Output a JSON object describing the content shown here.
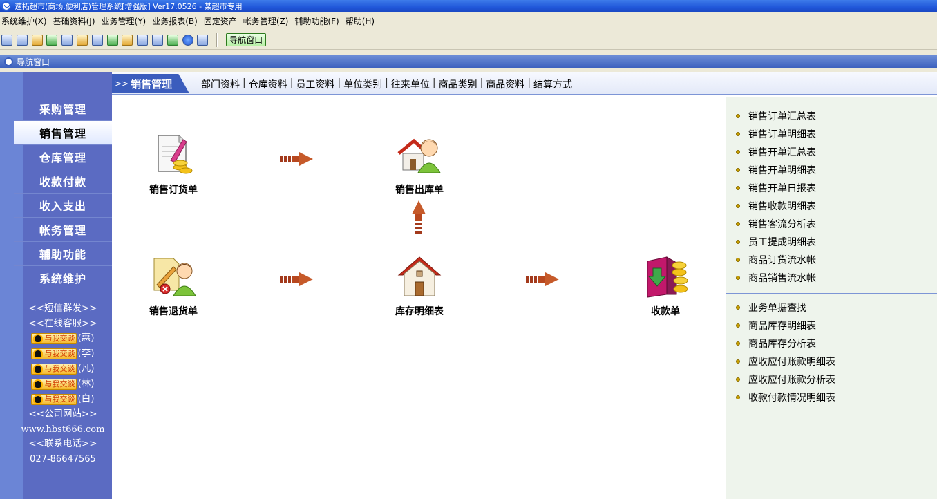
{
  "window": {
    "title": "速拓超市(商场,便利店)管理系统[增强版] Ver17.0526  -  某超市专用"
  },
  "menu": [
    "系统维护(X)",
    "基础资料(J)",
    "业务管理(Y)",
    "业务报表(B)",
    "固定资产",
    "帐务管理(Z)",
    "辅助功能(F)",
    "帮助(H)"
  ],
  "toolbar": {
    "nav_button_label": "导航窗口"
  },
  "nav_window": {
    "title": "导航窗口"
  },
  "sidebar": {
    "items": [
      {
        "label": "采购管理"
      },
      {
        "label": "销售管理"
      },
      {
        "label": "仓库管理"
      },
      {
        "label": "收款付款"
      },
      {
        "label": "收入支出"
      },
      {
        "label": "帐务管理"
      },
      {
        "label": "辅助功能"
      },
      {
        "label": "系统维护"
      }
    ],
    "active_index": 1,
    "sms": "<<短信群发>>",
    "online_service": "<<在线客服>>",
    "qq_label": "与我交谈",
    "qq_contacts": [
      "(惠)",
      "(李)",
      "(凡)",
      "(林)",
      "(白)"
    ],
    "website_title": "<<公司网站>>",
    "website": "www.hbst666.com",
    "phone_title": "<<联系电话>>",
    "phone": "027-86647565"
  },
  "main": {
    "section_prefix": ">>",
    "section_title": "销售管理",
    "quick_links": [
      "部门资料",
      "仓库资料",
      "员工资料",
      "单位类别",
      "往来单位",
      "商品类别",
      "商品资料",
      "结算方式"
    ],
    "flow": {
      "sales_order": "销售订货单",
      "sales_outbound": "销售出库单",
      "sales_return": "销售退货单",
      "inventory_detail": "库存明细表",
      "receipt": "收款单"
    }
  },
  "reports": {
    "group1": [
      "销售订单汇总表",
      "销售订单明细表",
      "销售开单汇总表",
      "销售开单明细表",
      "销售开单日报表",
      "销售收款明细表",
      "销售客流分析表",
      "员工提成明细表",
      "商品订货流水帐",
      "商品销售流水帐"
    ],
    "group2": [
      "业务单据查找",
      "商品库存明细表",
      "商品库存分析表",
      "应收应付账款明细表",
      "应收应付账款分析表",
      "收款付款情况明细表"
    ]
  }
}
